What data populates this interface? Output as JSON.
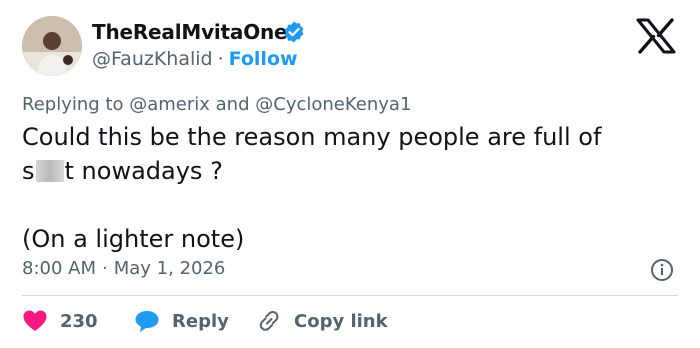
{
  "author": {
    "display_name": "TheRealMvitaOne",
    "handle": "@FauzKhalid",
    "separator": "·",
    "follow_label": "Follow"
  },
  "reply": {
    "prefix": "Replying to",
    "mention1": "@amerix",
    "conjunction": "and",
    "mention2": "@CycloneKenya1"
  },
  "text": {
    "line1": "Could this be the reason many people are full of",
    "line2_start": "s",
    "line2_end": "t nowadays ?",
    "line3": "(On a lighter note)"
  },
  "meta": {
    "time": "8:00 AM",
    "separator": "·",
    "date": "May 1, 2026"
  },
  "actions": {
    "likes": "230",
    "reply_label": "Reply",
    "copy_label": "Copy link"
  },
  "colors": {
    "accent": "#1d9bf0",
    "like": "#f91880",
    "secondary_text": "#536471",
    "divider": "#cfd9de"
  }
}
